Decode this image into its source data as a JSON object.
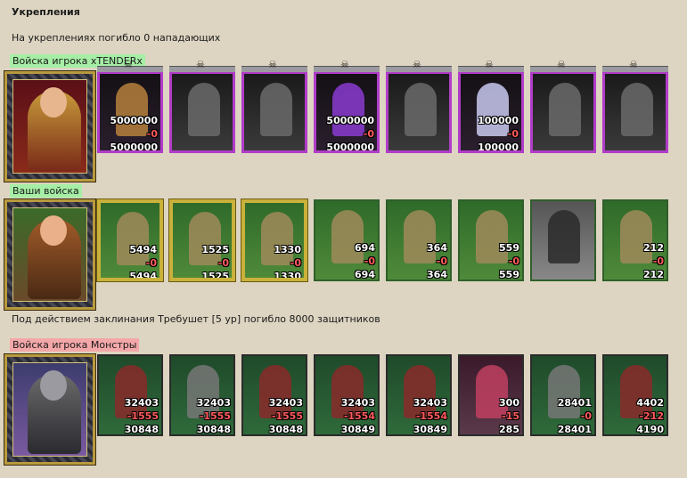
{
  "section_title": "Укрепления",
  "fortification_note": "На укреплениях погибло 0 нападающих",
  "attacker": {
    "label": "Войска игрока xTENDERx",
    "units": [
      {
        "name": "unit-1",
        "initial": "5000000",
        "lost": "-0",
        "remaining": "5000000",
        "style": "color"
      },
      {
        "name": "unit-2",
        "initial": "",
        "lost": "",
        "remaining": "",
        "style": "dark"
      },
      {
        "name": "unit-3",
        "initial": "",
        "lost": "",
        "remaining": "",
        "style": "dark"
      },
      {
        "name": "unit-4",
        "initial": "5000000",
        "lost": "-0",
        "remaining": "5000000",
        "style": "purple"
      },
      {
        "name": "unit-5",
        "initial": "",
        "lost": "",
        "remaining": "",
        "style": "dark"
      },
      {
        "name": "unit-6",
        "initial": "100000",
        "lost": "-0",
        "remaining": "100000",
        "style": "ghost"
      },
      {
        "name": "unit-7",
        "initial": "",
        "lost": "",
        "remaining": "",
        "style": "dark"
      },
      {
        "name": "unit-8",
        "initial": "",
        "lost": "",
        "remaining": "",
        "style": "dark"
      }
    ]
  },
  "defender": {
    "label": "Ваши войска",
    "units": [
      {
        "initial": "5494",
        "lost": "-0",
        "remaining": "5494",
        "gold": true
      },
      {
        "initial": "1525",
        "lost": "-0",
        "remaining": "1525",
        "gold": true
      },
      {
        "initial": "1330",
        "lost": "-0",
        "remaining": "1330",
        "gold": true
      },
      {
        "initial": "694",
        "lost": "-0",
        "remaining": "694",
        "gold": false
      },
      {
        "initial": "364",
        "lost": "-0",
        "remaining": "364",
        "gold": false
      },
      {
        "initial": "559",
        "lost": "-0",
        "remaining": "559",
        "gold": false
      },
      {
        "initial": "",
        "lost": "",
        "remaining": "",
        "gold": false,
        "grey": true
      },
      {
        "initial": "212",
        "lost": "-0",
        "remaining": "212",
        "gold": false
      }
    ]
  },
  "spell_note": "Под действием заклинания Требушет [5 ур] погибло 8000 защитников",
  "monsters": {
    "label": "Войска игрока Монстры",
    "units": [
      {
        "initial": "32403",
        "lost": "-1555",
        "remaining": "30848"
      },
      {
        "initial": "32403",
        "lost": "-1555",
        "remaining": "30848",
        "style": "silver"
      },
      {
        "initial": "32403",
        "lost": "-1555",
        "remaining": "30848"
      },
      {
        "initial": "32403",
        "lost": "-1554",
        "remaining": "30849"
      },
      {
        "initial": "32403",
        "lost": "-1554",
        "remaining": "30849"
      },
      {
        "initial": "300",
        "lost": "-15",
        "remaining": "285",
        "style": "pink"
      },
      {
        "initial": "28401",
        "lost": "-0",
        "remaining": "28401",
        "style": "silver"
      },
      {
        "initial": "4402",
        "lost": "-212",
        "remaining": "4190"
      }
    ]
  }
}
